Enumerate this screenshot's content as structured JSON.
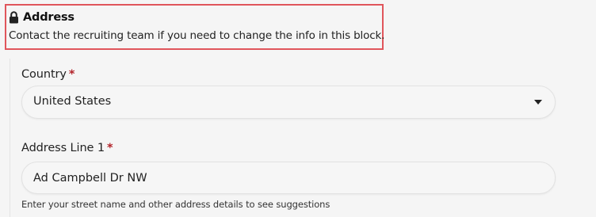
{
  "section": {
    "title": "Address",
    "description": "Contact the recruiting team if you need to change the info in this block.",
    "icon": "lock-icon",
    "highlight_color": "#e0555b"
  },
  "fields": {
    "country": {
      "label": "Country",
      "required_marker": "*",
      "value": "United States"
    },
    "address_line_1": {
      "label": "Address Line 1",
      "required_marker": "*",
      "value": "Ad Campbell Dr NW",
      "hint": "Enter your street name and other address details to see suggestions"
    }
  },
  "colors": {
    "required": "#b3232a",
    "background": "#f5f5f5"
  }
}
